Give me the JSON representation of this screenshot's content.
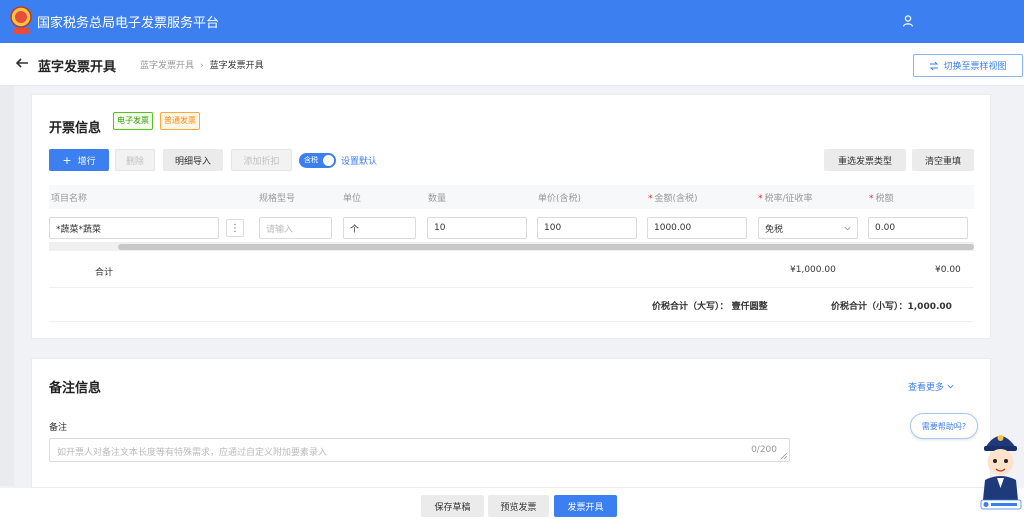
{
  "header": {
    "app_title": "国家税务总局电子发票服务平台",
    "brand_color": "#3b7ff0"
  },
  "subheader": {
    "page_title": "蓝字发票开具",
    "breadcrumb": [
      "蓝字发票开具",
      "蓝字发票开具"
    ],
    "switch_view_label": "切换至票样视图"
  },
  "invoice_info": {
    "section_title": "开票信息",
    "tags": [
      "电子发票",
      "普通发票"
    ],
    "toolbar": {
      "add_row": "增行",
      "delete": "删除",
      "import_details": "明细导入",
      "add_discount": "添加折扣",
      "tax_toggle_text": "含税",
      "set_default": "设置默认",
      "reselect_type": "重选发票类型",
      "clear_refill": "清空重填"
    },
    "columns": [
      "项目名称",
      "规格型号",
      "单位",
      "数量",
      "单价(含税)",
      "金额(含税)",
      "税率/征收率",
      "税额"
    ],
    "row": {
      "item_name": "*蔬菜*蔬菜",
      "spec_placeholder": "请输入",
      "unit": "个",
      "quantity": "10",
      "unit_price": "100",
      "amount": "1000.00",
      "tax_rate": "免税",
      "tax": "0.00"
    },
    "subtotal": {
      "label": "合计",
      "amount": "¥1,000.00",
      "tax": "¥0.00"
    },
    "total_upper": "价税合计（大写）： 壹仟圆整",
    "total_lower": "价税合计（小写）：1,000.00"
  },
  "remarks": {
    "section_title": "备注信息",
    "see_more": "查看更多",
    "label": "备注",
    "placeholder": "如开票人对备注文本长度等有特殊需求，应通过自定义附加要素录入",
    "counter": "0/200"
  },
  "footer": {
    "save_draft": "保存草稿",
    "preview": "预览发票",
    "issue": "发票开具"
  },
  "help": {
    "bubble_text": "需要帮助吗?"
  }
}
